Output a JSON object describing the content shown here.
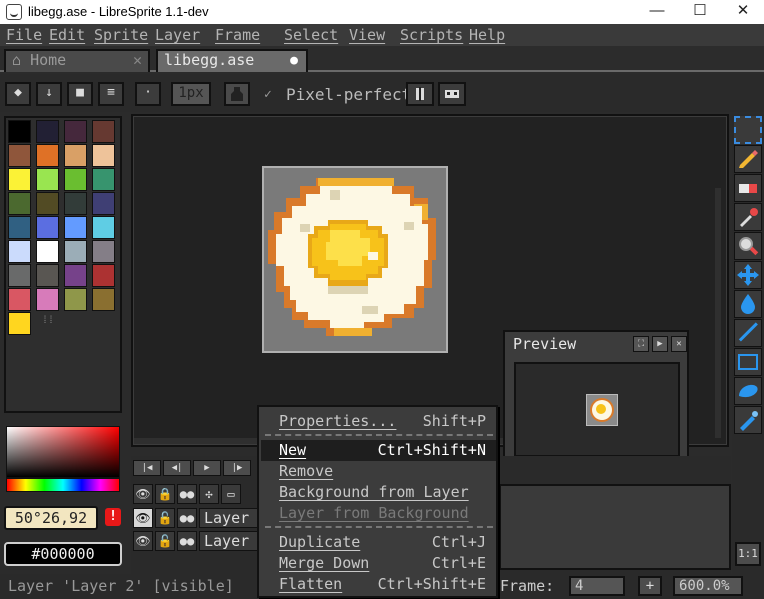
{
  "window": {
    "title": "libegg.ase - LibreSprite 1.1-dev",
    "minimize": "—",
    "maximize": "☐",
    "close": "✕"
  },
  "menu": [
    "File",
    "Edit",
    "Sprite",
    "Layer",
    "Frame",
    "Select",
    "View",
    "Scripts",
    "Help"
  ],
  "tabs": {
    "home": {
      "icon": "⌂",
      "label": "Home",
      "close": "✕"
    },
    "file": {
      "label": "libegg.ase",
      "modified": "●"
    }
  },
  "toolbar": {
    "brush_type_icons": [
      "◆",
      "↓",
      "■",
      "≡"
    ],
    "brush_dot": "·",
    "brush_size": "1px",
    "pixel_perfect_check": "✓",
    "pixel_perfect_label": "Pixel-perfect"
  },
  "palette": {
    "colors": [
      "#000000",
      "#222034",
      "#45283c",
      "#663931",
      "#8f563b",
      "#df7126",
      "#d9a066",
      "#eec39a",
      "#fbf236",
      "#99e550",
      "#6abe30",
      "#37946e",
      "#4b692f",
      "#524b24",
      "#323c39",
      "#3f3f74",
      "#306082",
      "#5b6ee1",
      "#639bff",
      "#5fcde4",
      "#cbdbfc",
      "#ffffff",
      "#9badb7",
      "#847e87",
      "#696a6a",
      "#595652",
      "#76428a",
      "#ac3232",
      "#d95763",
      "#d77bba",
      "#8f974a",
      "#8a6f30",
      "#ffd61f"
    ],
    "grip": "⁞⁞"
  },
  "color_picker": {
    "coords": "50°26,92",
    "warning": "!",
    "hex": "#000000"
  },
  "preview": {
    "title": "Preview",
    "buttons": [
      "⛶",
      "▶",
      "✕"
    ]
  },
  "timeline": {
    "nav_buttons": [
      "|◀",
      "◀|",
      "▶",
      "|▶"
    ],
    "header_icons": [
      "👁",
      "🔒",
      "●●",
      "✣",
      "▭"
    ],
    "layers": [
      {
        "visible_icon": "👁",
        "lock_icon": "🔓",
        "cont_icon": "●●",
        "name": "Layer"
      },
      {
        "visible_icon": "👁",
        "lock_icon": "🔓",
        "cont_icon": "●●",
        "name": "Layer"
      }
    ]
  },
  "status": {
    "text": "Layer 'Layer 2' [visible]",
    "frame_label": "Frame:",
    "frame_value": "4",
    "add_frame": "+",
    "zoom": "600.0%",
    "fit_button": "1:1"
  },
  "tools": [
    "marquee-tool",
    "pencil-tool",
    "eraser-tool",
    "eyedropper-tool",
    "zoom-tool",
    "move-tool",
    "paint-bucket-tool",
    "line-tool",
    "rectangle-tool",
    "contour-tool",
    "blur-tool"
  ],
  "context_menu": {
    "items": [
      {
        "label": "Properties...",
        "shortcut": "Shift+P",
        "state": "en"
      },
      {
        "label": "New",
        "shortcut": "Ctrl+Shift+N",
        "state": "hl"
      },
      {
        "label": "Remove",
        "shortcut": "",
        "state": "en"
      },
      {
        "label": "Background from Layer",
        "shortcut": "",
        "state": "en"
      },
      {
        "label": "Layer from Background",
        "shortcut": "",
        "state": "dis"
      },
      {
        "label": "Duplicate",
        "shortcut": "Ctrl+J",
        "state": "en"
      },
      {
        "label": "Merge Down",
        "shortcut": "Ctrl+E",
        "state": "en"
      },
      {
        "label": "Flatten",
        "shortcut": "Ctrl+Shift+E",
        "state": "en"
      }
    ]
  },
  "colors": {
    "egg_white": "#fdf8e4",
    "egg_shadow": "#ddd4b4",
    "egg_crust": "#d97a2a",
    "egg_crust_light": "#f0b030",
    "yolk": "#f7c21a",
    "yolk_light": "#fde04a",
    "sprite_bg": "#7a7a7a"
  }
}
